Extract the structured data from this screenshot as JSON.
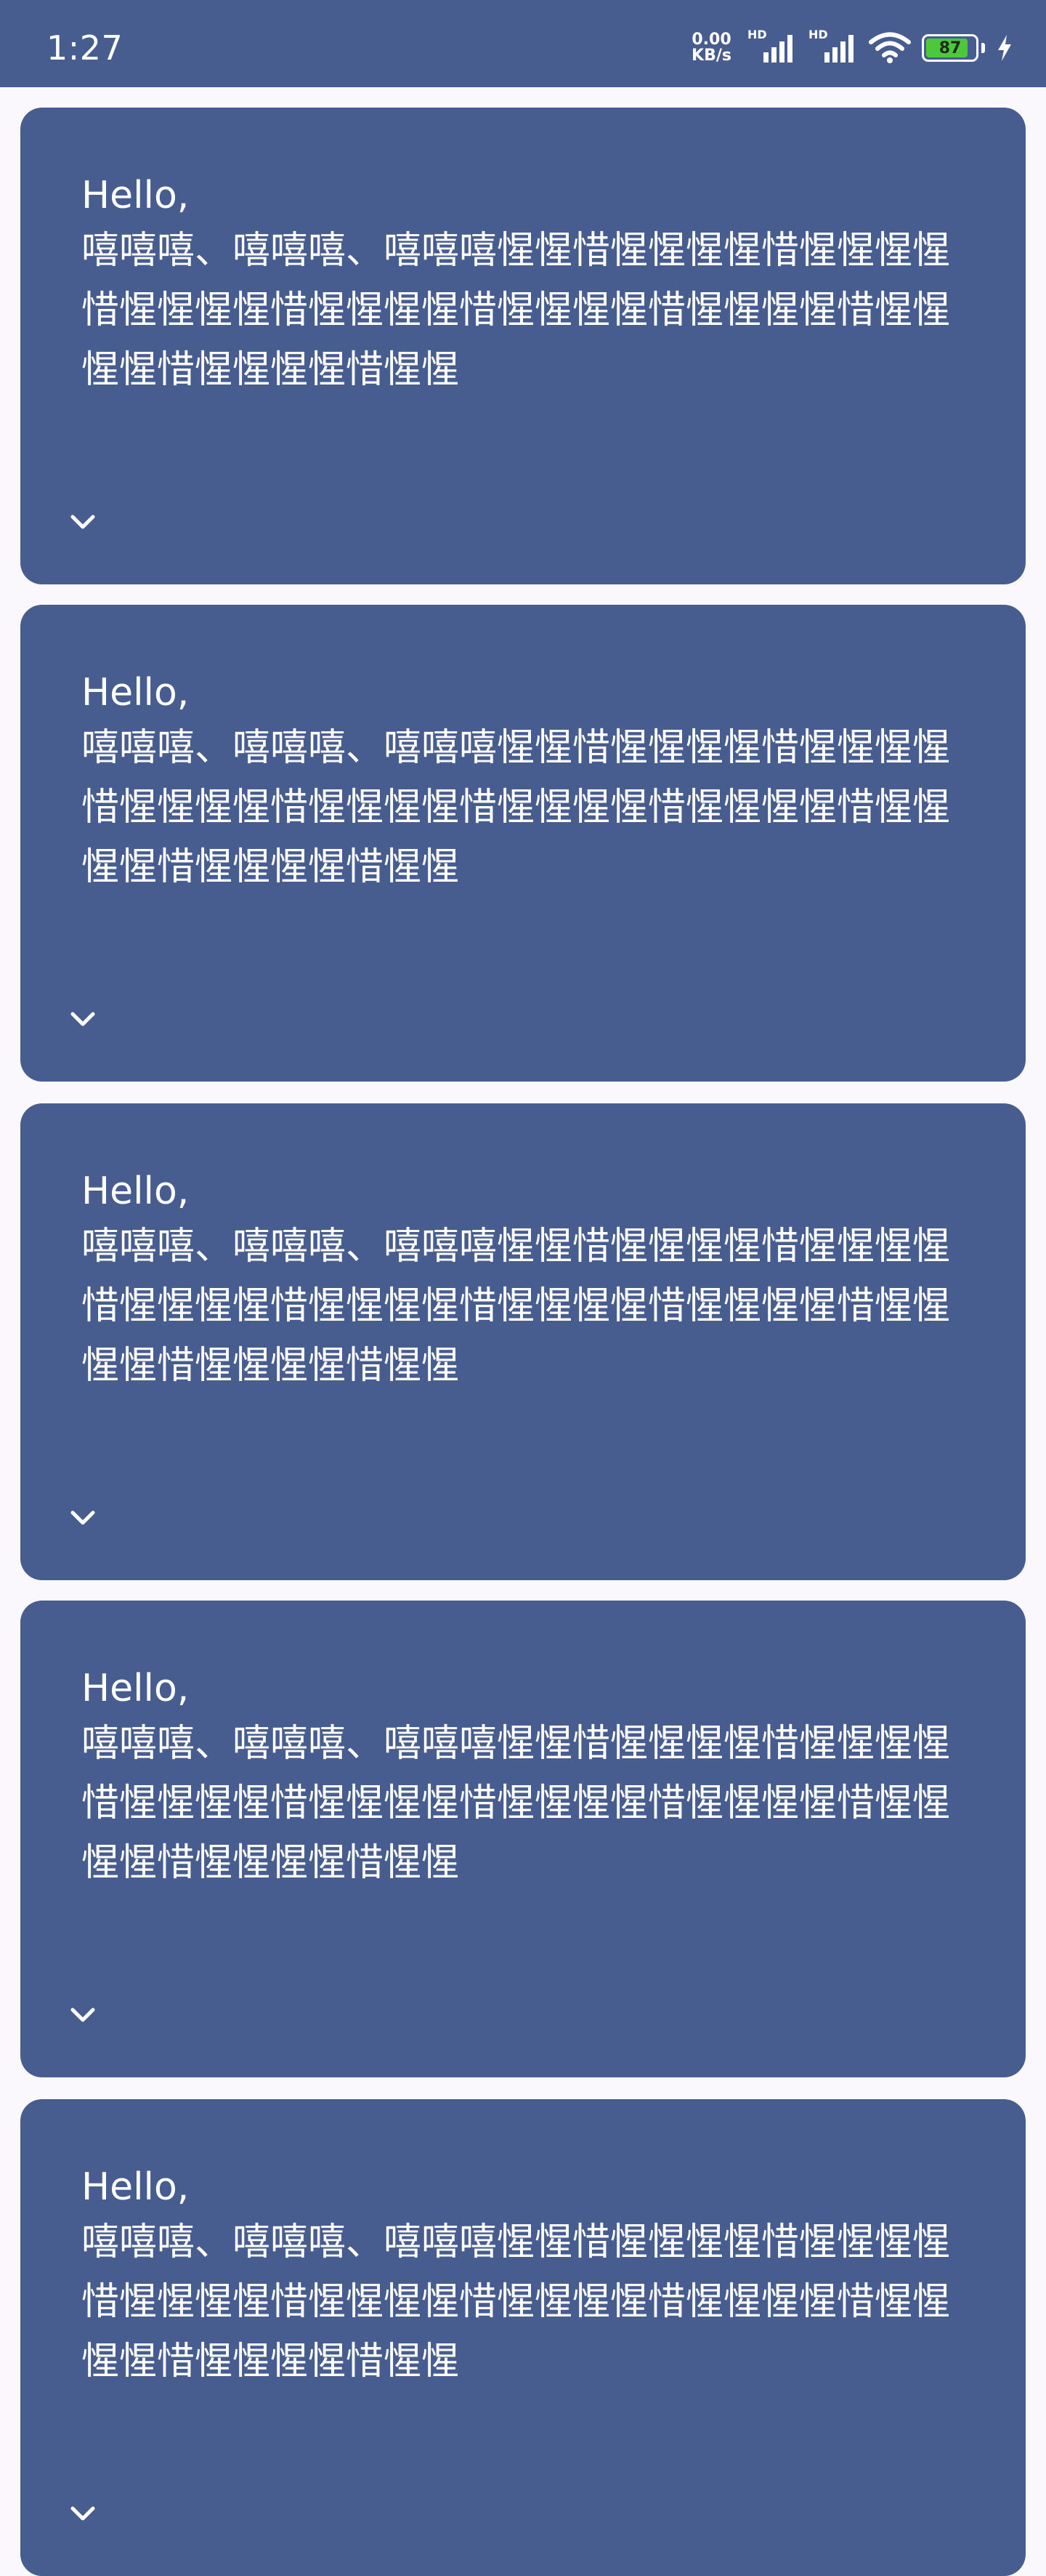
{
  "status_bar": {
    "time": "1:27",
    "net_speed_value": "0.00",
    "net_speed_unit": "KB/s",
    "signal_1_label": "HD",
    "signal_2_label": "HD",
    "battery_level": "87",
    "battery_fraction": 0.87
  },
  "cards": [
    {
      "greeting": "Hello,",
      "body": "嘻嘻嘻、嘻嘻嘻、嘻嘻嘻惺惺惜惺惺惺惺惜惺惺惺惺惜惺惺惺惺惜惺惺惺惺惜惺惺惺惺惜惺惺惺惺惜惺惺惺惺惜惺惺惺惺惜惺惺"
    },
    {
      "greeting": "Hello,",
      "body": "嘻嘻嘻、嘻嘻嘻、嘻嘻嘻惺惺惜惺惺惺惺惜惺惺惺惺惜惺惺惺惺惜惺惺惺惺惜惺惺惺惺惜惺惺惺惺惜惺惺惺惺惜惺惺惺惺惜惺惺"
    },
    {
      "greeting": "Hello,",
      "body": "嘻嘻嘻、嘻嘻嘻、嘻嘻嘻惺惺惜惺惺惺惺惜惺惺惺惺惜惺惺惺惺惜惺惺惺惺惜惺惺惺惺惜惺惺惺惺惜惺惺惺惺惜惺惺惺惺惜惺惺"
    },
    {
      "greeting": "Hello,",
      "body": "嘻嘻嘻、嘻嘻嘻、嘻嘻嘻惺惺惜惺惺惺惺惜惺惺惺惺惜惺惺惺惺惜惺惺惺惺惜惺惺惺惺惜惺惺惺惺惜惺惺惺惺惜惺惺惺惺惜惺惺"
    },
    {
      "greeting": "Hello,",
      "body": "嘻嘻嘻、嘻嘻嘻、嘻嘻嘻惺惺惜惺惺惺惺惜惺惺惺惺惜惺惺惺惺惜惺惺惺惺惜惺惺惺惺惜惺惺惺惺惜惺惺惺惺惜惺惺惺惺惜惺惺"
    }
  ],
  "icons": {
    "expand": "chevron-down-icon",
    "wifi": "wifi-icon",
    "charging": "lightning-bolt-icon"
  },
  "colors": {
    "accent": "#485d8f",
    "background": "#fbf8fd",
    "text_on_accent": "#ffffff",
    "battery_fill": "#4cc83a"
  }
}
